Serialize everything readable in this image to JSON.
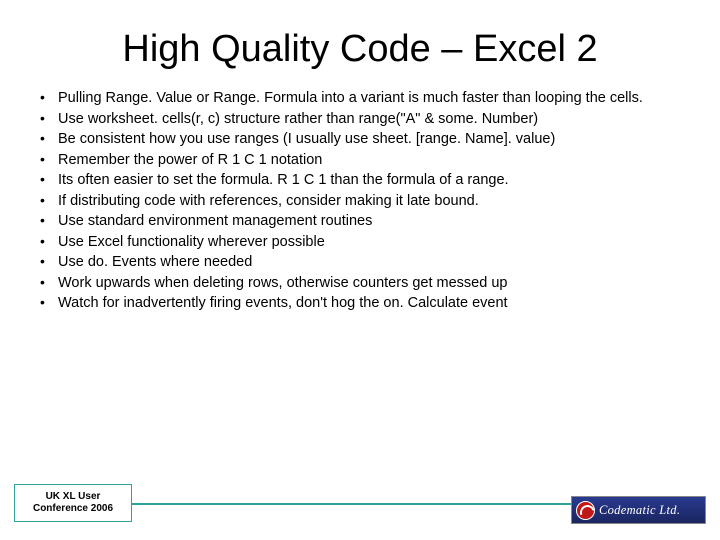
{
  "title": "High Quality Code – Excel 2",
  "bullets": [
    "Pulling Range. Value or Range. Formula into a variant is much faster than looping the cells.",
    "Use worksheet. cells(r, c) structure rather than range(\"A\" & some. Number)",
    "Be consistent how you use ranges (I usually use sheet. [range. Name]. value)",
    "Remember the power of R 1 C 1 notation",
    "Its often easier to set the formula. R 1 C 1 than the formula of a range.",
    "If distributing code with references, consider making it late bound.",
    "Use standard environment management routines",
    "Use Excel functionality wherever possible",
    "Use do. Events where needed",
    "Work upwards when deleting rows, otherwise counters get messed up",
    "Watch for inadvertently firing events, don't hog the on. Calculate event"
  ],
  "footer": {
    "line1": "UK XL User",
    "line2": "Conference 2006"
  },
  "logo_text": "Codematic Ltd."
}
